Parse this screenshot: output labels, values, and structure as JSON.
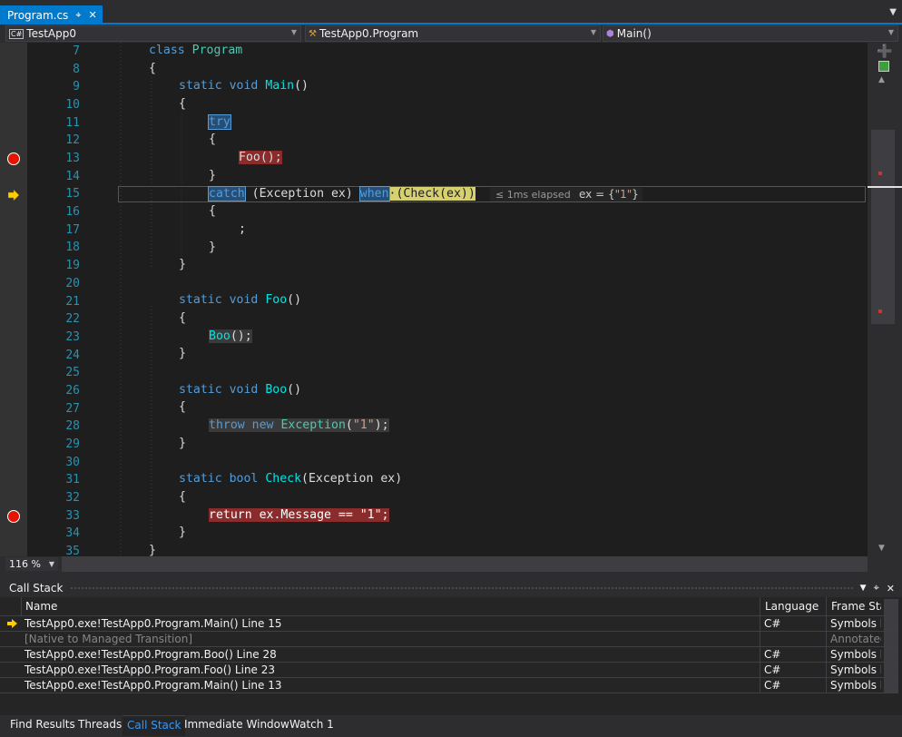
{
  "tab": {
    "title": "Program.cs",
    "pin_icon": "pin-icon",
    "close_icon": "close-icon"
  },
  "nav": {
    "project": "TestApp0",
    "class": "TestApp0.Program",
    "member": "Main()"
  },
  "editor": {
    "lines": [
      {
        "n": "7"
      },
      {
        "n": "8"
      },
      {
        "n": "9"
      },
      {
        "n": "10"
      },
      {
        "n": "11"
      },
      {
        "n": "12"
      },
      {
        "n": "13"
      },
      {
        "n": "14"
      },
      {
        "n": "15"
      },
      {
        "n": "16"
      },
      {
        "n": "17"
      },
      {
        "n": "18"
      },
      {
        "n": "19"
      },
      {
        "n": "20"
      },
      {
        "n": "21"
      },
      {
        "n": "22"
      },
      {
        "n": "23"
      },
      {
        "n": "24"
      },
      {
        "n": "25"
      },
      {
        "n": "26"
      },
      {
        "n": "27"
      },
      {
        "n": "28"
      },
      {
        "n": "29"
      },
      {
        "n": "30"
      },
      {
        "n": "31"
      },
      {
        "n": "32"
      },
      {
        "n": "33"
      },
      {
        "n": "34"
      },
      {
        "n": "35"
      }
    ],
    "perf_tip": "≤ 1ms elapsed",
    "datatip_label": "ex = {",
    "datatip_value": "\"1\"",
    "datatip_close": "}"
  },
  "zoom": "116 %",
  "callstack": {
    "title": "Call Stack",
    "columns": [
      "Name",
      "Language",
      "Frame Stat"
    ],
    "rows": [
      {
        "name": "TestApp0.exe!TestApp0.Program.Main() Line 15",
        "lang": "C#",
        "status": "Symbols lo",
        "current": true
      },
      {
        "name": "[Native to Managed Transition]",
        "lang": "",
        "status": "Annotated",
        "current": false
      },
      {
        "name": "TestApp0.exe!TestApp0.Program.Boo() Line 28",
        "lang": "C#",
        "status": "Symbols lo",
        "current": false
      },
      {
        "name": "TestApp0.exe!TestApp0.Program.Foo() Line 23",
        "lang": "C#",
        "status": "Symbols lo",
        "current": false
      },
      {
        "name": "TestApp0.exe!TestApp0.Program.Main() Line 13",
        "lang": "C#",
        "status": "Symbols lo",
        "current": false
      }
    ]
  },
  "bottom_tabs": [
    "Find Results",
    "Threads",
    "Call Stack",
    "Immediate Window",
    "Watch 1"
  ],
  "code": {
    "l7_kw": "class",
    "l7_name": "Program",
    "l9_kw1": "static",
    "l9_kw2": "void",
    "l9_name": "Main",
    "l9_rest": "()",
    "l11_kw": "try",
    "l13_call": "Foo();",
    "l15_kw": "catch",
    "l15_rest": " (Exception ex) ",
    "l15_when": "when",
    "l15_cond": "(Check(ex))",
    "l17_semi": ";",
    "l21_kw1": "static",
    "l21_kw2": "void",
    "l21_name": "Foo",
    "l21_rest": "()",
    "l23_call": "Boo",
    "l23_rest": "();",
    "l26_kw1": "static",
    "l26_kw2": "void",
    "l26_name": "Boo",
    "l26_rest": "()",
    "l28_kw1": "throw",
    "l28_kw2": "new",
    "l28_type": "Exception",
    "l28_p1": "(",
    "l28_str": "\"1\"",
    "l28_p2": ");",
    "l31_kw1": "static",
    "l31_kw2": "bool",
    "l31_name": "Check",
    "l31_rest": "(Exception ex)",
    "l33_text": "return ex.Message == \"1\";",
    "open": "{",
    "close": "}"
  },
  "colors": {
    "accent": "#007acc",
    "breakpoint": "#e51400",
    "arrow": "#ffcc00"
  }
}
